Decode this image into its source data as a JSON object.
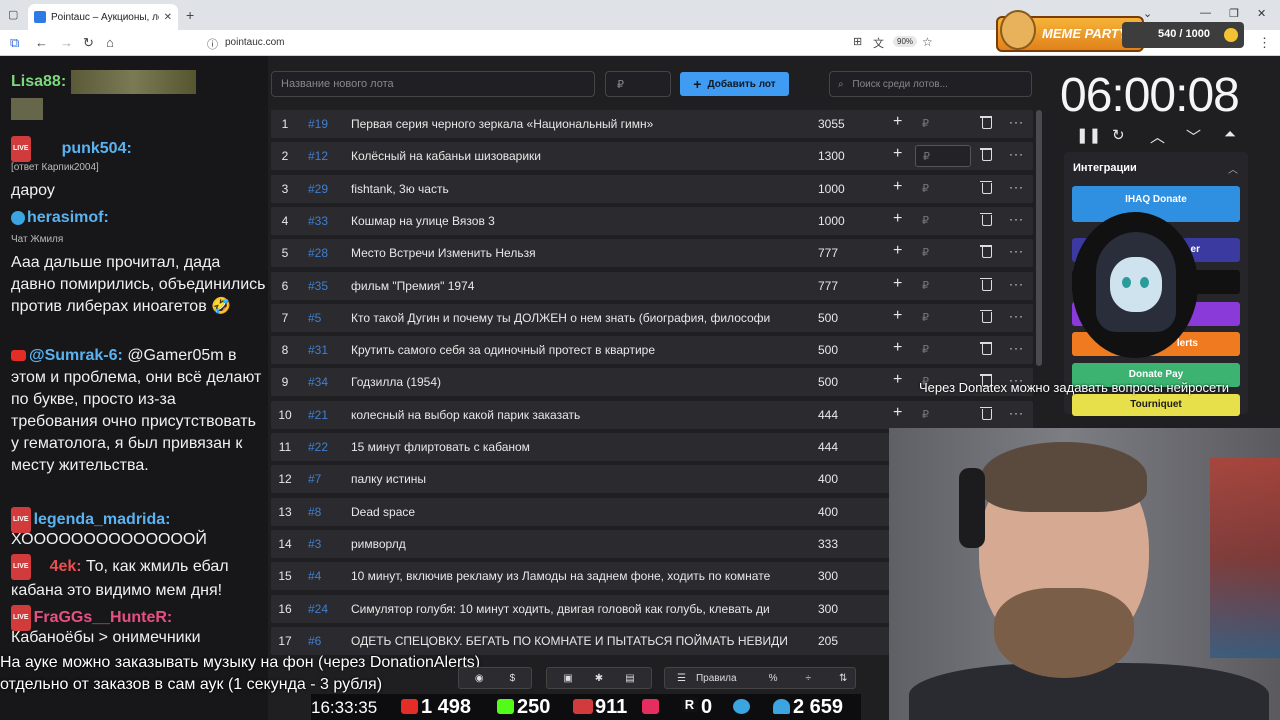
{
  "browser": {
    "tab_title": "Pointauc – Аукционы, лотереи",
    "url": "pointauc.com",
    "zoom": "90%"
  },
  "meme_party": {
    "logo": "MEME PARTY",
    "score": "540 / 1000"
  },
  "chat": {
    "messages": [
      {
        "nick": "Lisa88:",
        "text": ""
      },
      {
        "nick": "punk504:",
        "reply": "[ответ Карпик2004]",
        "text": "дароу"
      },
      {
        "nick": "herasimof:",
        "reply": "Чат Жмиля",
        "text": "Ааа дальше прочитал, дада давно помирились, объединились против либерах иноагетов 🤣"
      },
      {
        "nick": "@Sumrak-6:",
        "text": "@Gamer05m в этом и проблема, они всё делают по букве, просто из-за требования очно присутствовать у гематолога, я был привязан к месту жительства."
      },
      {
        "nick": "legenda_madrida:",
        "text": "ХООООООООООООООЙ"
      },
      {
        "nick": "4ek:",
        "text": "То, как жмиль ебал кабана это видимо мем дня!"
      },
      {
        "nick": "FraGGs__HunteR:",
        "text": "Кабаноёбы > онимечники"
      }
    ]
  },
  "controls": {
    "lot_placeholder": "Название нового лота",
    "price_placeholder": "₽",
    "add_label": "Добавить лот",
    "search_placeholder": "Поиск среди лотов..."
  },
  "lots": [
    {
      "n": "1",
      "id": "#19",
      "name": "Первая серия черного зеркала «Национальный гимн»",
      "amount": "3055"
    },
    {
      "n": "2",
      "id": "#12",
      "name": "Колёсный на кабаньи шизоварики",
      "amount": "1300"
    },
    {
      "n": "3",
      "id": "#29",
      "name": "fishtank, 3ю часть",
      "amount": "1000"
    },
    {
      "n": "4",
      "id": "#33",
      "name": "Кошмар на улице Вязов 3",
      "amount": "1000"
    },
    {
      "n": "5",
      "id": "#28",
      "name": "Место Встречи Изменить Нельзя",
      "amount": "777"
    },
    {
      "n": "6",
      "id": "#35",
      "name": "фильм \"Премия\" 1974",
      "amount": "777"
    },
    {
      "n": "7",
      "id": "#5",
      "name": "Кто такой Дугин и почему ты ДОЛЖЕН о нем знать (биография, философи",
      "amount": "500"
    },
    {
      "n": "8",
      "id": "#31",
      "name": "Крутить самого себя за одиночный протест в квартире",
      "amount": "500"
    },
    {
      "n": "9",
      "id": "#34",
      "name": "Годзилла (1954)",
      "amount": "500"
    },
    {
      "n": "10",
      "id": "#21",
      "name": "колесный на выбор какой парик заказать",
      "amount": "444"
    },
    {
      "n": "11",
      "id": "#22",
      "name": "15 минут флиртовать с кабаном",
      "amount": "444"
    },
    {
      "n": "12",
      "id": "#7",
      "name": "палку истины",
      "amount": "400"
    },
    {
      "n": "13",
      "id": "#8",
      "name": "Dead space",
      "amount": "400"
    },
    {
      "n": "14",
      "id": "#3",
      "name": "римворлд",
      "amount": "333"
    },
    {
      "n": "15",
      "id": "#4",
      "name": "10 минут, включив рекламу из Ламоды на заднем фоне, ходить по комнате",
      "amount": "300"
    },
    {
      "n": "16",
      "id": "#24",
      "name": "Симулятор голубя: 10 минут ходить, двигая головой как голубь, клевать ди",
      "amount": "300"
    },
    {
      "n": "17",
      "id": "#6",
      "name": "ОДЕТЬ СПЕЦОВКУ. БЕГАТЬ ПО КОМНАТЕ И ПЫТАТЬСЯ ПОЙМАТЬ НЕВИДИ",
      "amount": "205"
    }
  ],
  "lot_row": {
    "plus": "+",
    "currency": "₽",
    "more": "···"
  },
  "timer": "06:00:08",
  "integrations": {
    "title": "Интеграции",
    "items": [
      {
        "label": "IHAQ Donate",
        "color": "#2f8fe0"
      },
      {
        "label": "er",
        "color": "#3a3aa0"
      },
      {
        "label": "",
        "color": "#1a1a1a"
      },
      {
        "label": "",
        "color": "#8a3ad8"
      },
      {
        "label": "lerts",
        "color": "#f07a20"
      },
      {
        "label": "Donate Pay",
        "color": "#3cb371"
      },
      {
        "label": "Tourniquet",
        "color": "#e8e04a"
      }
    ]
  },
  "donatex_text": "Через Donatex можно задавать вопросы нейросети",
  "subtitle": {
    "line1": "На ауке можно заказывать музыку на фон (через DonationAlerts)",
    "line2": "отдельно от заказов в сам аук (1 секунда - 3 рубля)"
  },
  "toolbar": {
    "rules_label": "Правила",
    "percent": "%"
  },
  "stats": {
    "time": "16:33:35",
    "youtube": "1 498",
    "kick": "250",
    "vk": "911",
    "rutube": "0",
    "telegram": "",
    "total": "2 659"
  },
  "colors": {
    "accent": "#3f9cf2",
    "lot_id": "#3f7fd0",
    "live_badge": "#d23b3b"
  }
}
